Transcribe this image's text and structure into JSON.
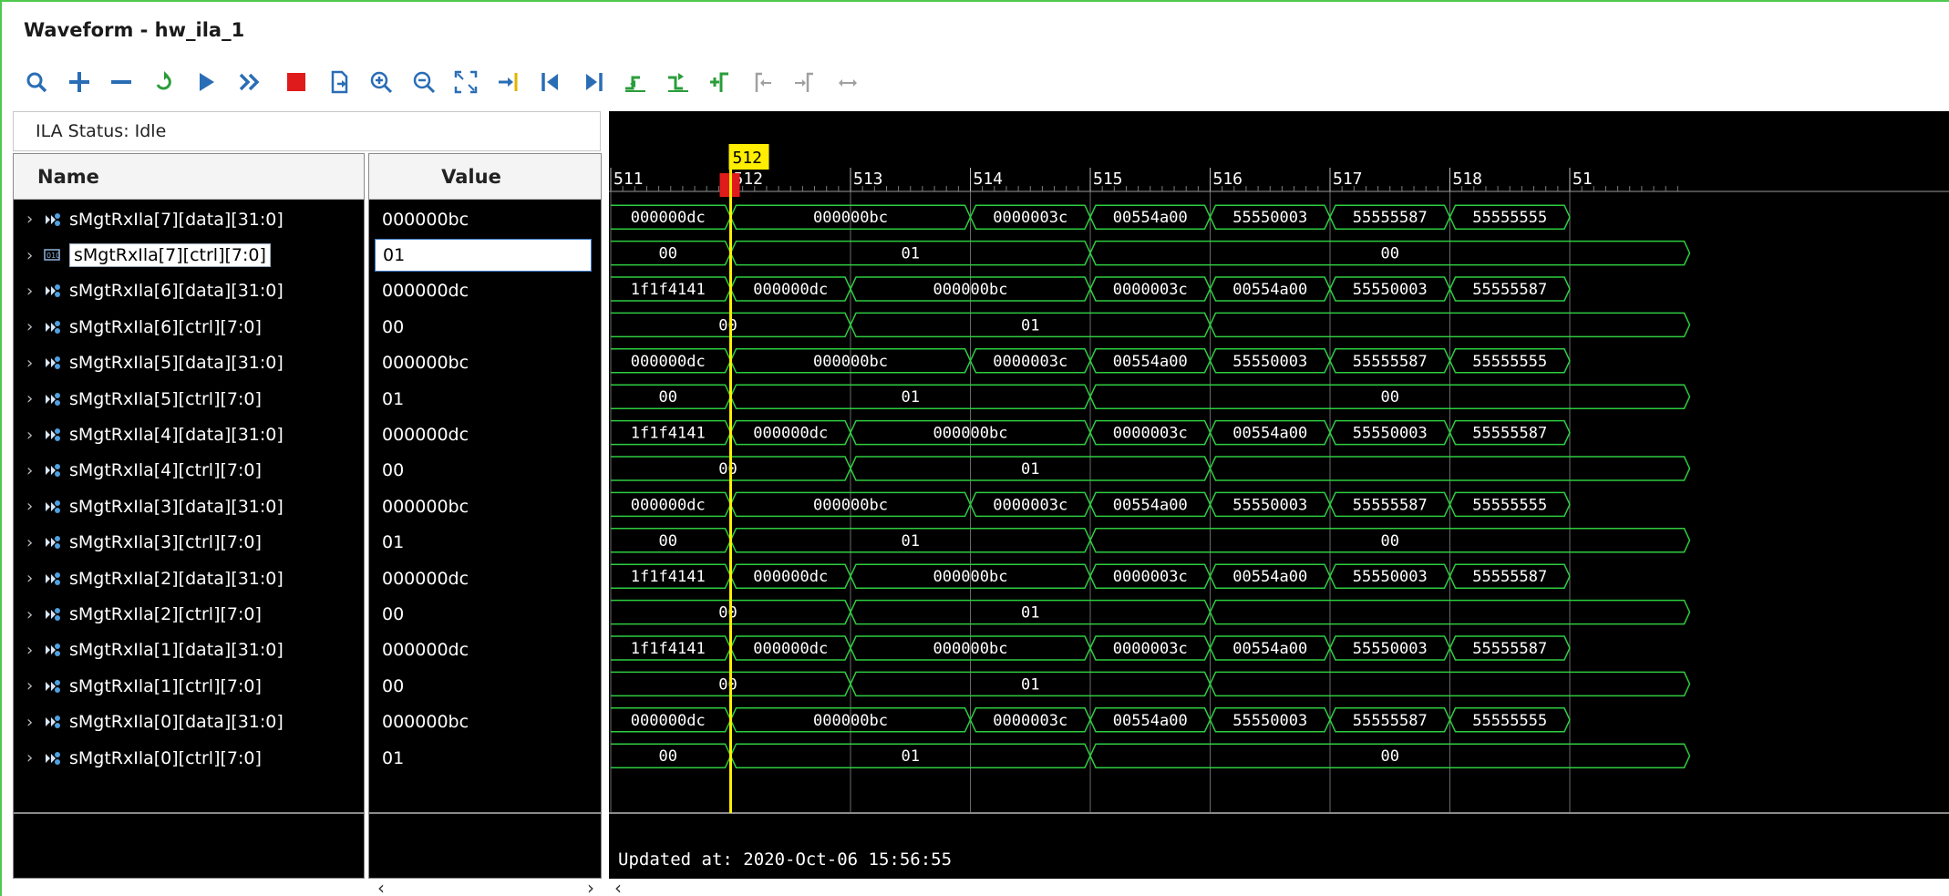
{
  "window": {
    "title": "Waveform - hw_ila_1"
  },
  "toolbar": {
    "buttons": [
      {
        "icon": "search-icon",
        "color": "#2a6db5"
      },
      {
        "icon": "plus-icon",
        "color": "#2a6db5"
      },
      {
        "icon": "minus-icon",
        "color": "#2a6db5"
      },
      {
        "icon": "run-trigger-immediate-icon",
        "color": "#2a9d3a"
      },
      {
        "icon": "play-icon",
        "color": "#2a6db5"
      },
      {
        "icon": "fast-forward-icon",
        "color": "#2a6db5"
      },
      {
        "icon": "stop-icon",
        "color": "#e01b1b"
      },
      {
        "icon": "export-icon",
        "color": "#2a6db5"
      },
      {
        "icon": "zoom-in-icon",
        "color": "#2a6db5"
      },
      {
        "icon": "zoom-out-icon",
        "color": "#2a6db5"
      },
      {
        "icon": "zoom-fit-icon",
        "color": "#2a6db5"
      },
      {
        "icon": "go-to-cursor-icon",
        "color": "#2a6db5"
      },
      {
        "icon": "go-to-start-icon",
        "color": "#2a6db5"
      },
      {
        "icon": "go-to-end-icon",
        "color": "#2a6db5"
      },
      {
        "icon": "previous-transition-icon",
        "color": "#2a9d3a"
      },
      {
        "icon": "next-transition-icon",
        "color": "#2a9d3a"
      },
      {
        "icon": "add-marker-icon",
        "color": "#2a9d3a"
      },
      {
        "icon": "previous-marker-icon",
        "color": "#a0a0a0"
      },
      {
        "icon": "next-marker-icon",
        "color": "#a0a0a0"
      },
      {
        "icon": "swap-cursors-icon",
        "color": "#a0a0a0"
      }
    ]
  },
  "status": {
    "text": "ILA Status: Idle"
  },
  "columns": {
    "name": "Name",
    "value": "Value"
  },
  "signals": [
    {
      "name": "sMgtRxIla[7][data][31:0]",
      "value": "000000bc",
      "selected": false
    },
    {
      "name": "sMgtRxIla[7][ctrl][7:0]",
      "value": "01",
      "selected": true
    },
    {
      "name": "sMgtRxIla[6][data][31:0]",
      "value": "000000dc",
      "selected": false
    },
    {
      "name": "sMgtRxIla[6][ctrl][7:0]",
      "value": "00",
      "selected": false
    },
    {
      "name": "sMgtRxIla[5][data][31:0]",
      "value": "000000bc",
      "selected": false
    },
    {
      "name": "sMgtRxIla[5][ctrl][7:0]",
      "value": "01",
      "selected": false
    },
    {
      "name": "sMgtRxIla[4][data][31:0]",
      "value": "000000dc",
      "selected": false
    },
    {
      "name": "sMgtRxIla[4][ctrl][7:0]",
      "value": "00",
      "selected": false
    },
    {
      "name": "sMgtRxIla[3][data][31:0]",
      "value": "000000bc",
      "selected": false
    },
    {
      "name": "sMgtRxIla[3][ctrl][7:0]",
      "value": "01",
      "selected": false
    },
    {
      "name": "sMgtRxIla[2][data][31:0]",
      "value": "000000dc",
      "selected": false
    },
    {
      "name": "sMgtRxIla[2][ctrl][7:0]",
      "value": "00",
      "selected": false
    },
    {
      "name": "sMgtRxIla[1][data][31:0]",
      "value": "000000dc",
      "selected": false
    },
    {
      "name": "sMgtRxIla[1][ctrl][7:0]",
      "value": "00",
      "selected": false
    },
    {
      "name": "sMgtRxIla[0][data][31:0]",
      "value": "000000bc",
      "selected": false
    },
    {
      "name": "sMgtRxIla[0][ctrl][7:0]",
      "value": "01",
      "selected": false
    }
  ],
  "waveform": {
    "cursor_label": "512",
    "cursor_sample": 512,
    "view_start": 511,
    "ruler_labels": [
      "511",
      "512",
      "513",
      "514",
      "515",
      "516",
      "517",
      "518",
      "51"
    ],
    "colors": {
      "trace": "#2ecc40",
      "cursor": "#ffee00",
      "grid": "#6a6a6a",
      "background": "#000000",
      "text": "#ffffff",
      "cursor_marker": "#e01b1b"
    },
    "updated_text": "Updated at: 2020-Oct-06 15:56:55",
    "patterns": {
      "A": [
        {
          "from": 511,
          "to": 512,
          "value": "000000dc"
        },
        {
          "from": 512,
          "to": 514,
          "value": "000000bc"
        },
        {
          "from": 514,
          "to": 515,
          "value": "0000003c"
        },
        {
          "from": 515,
          "to": 516,
          "value": "00554a00"
        },
        {
          "from": 516,
          "to": 517,
          "value": "55550003"
        },
        {
          "from": 517,
          "to": 518,
          "value": "55555587"
        },
        {
          "from": 518,
          "to": 519,
          "value": "55555555"
        }
      ],
      "B": [
        {
          "from": 511,
          "to": 512,
          "value": "00"
        },
        {
          "from": 512,
          "to": 515,
          "value": "01"
        },
        {
          "from": 515,
          "to": 520,
          "value": "00"
        }
      ],
      "C": [
        {
          "from": 511,
          "to": 512,
          "value": "1f1f4141"
        },
        {
          "from": 512,
          "to": 513,
          "value": "000000dc"
        },
        {
          "from": 513,
          "to": 515,
          "value": "000000bc"
        },
        {
          "from": 515,
          "to": 516,
          "value": "0000003c"
        },
        {
          "from": 516,
          "to": 517,
          "value": "00554a00"
        },
        {
          "from": 517,
          "to": 518,
          "value": "55550003"
        },
        {
          "from": 518,
          "to": 519,
          "value": "55555587"
        }
      ],
      "D": [
        {
          "from": 511,
          "to": 513,
          "value": "00"
        },
        {
          "from": 513,
          "to": 516,
          "value": "01"
        },
        {
          "from": 516,
          "to": 520,
          "value": ""
        }
      ]
    },
    "row_patterns": [
      "A",
      "B",
      "C",
      "D",
      "A",
      "B",
      "C",
      "D",
      "A",
      "B",
      "C",
      "D",
      "C",
      "D",
      "A",
      "B"
    ]
  },
  "scroll": {
    "left": "‹",
    "right": "›"
  }
}
